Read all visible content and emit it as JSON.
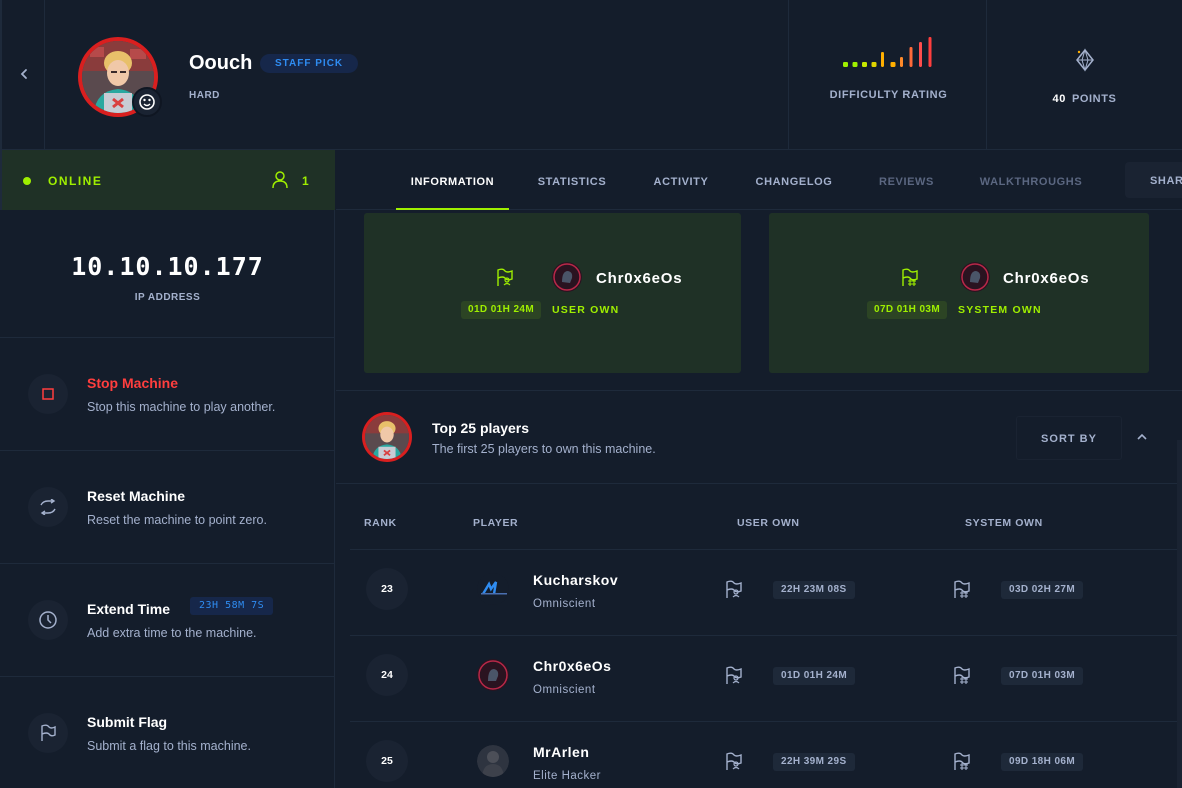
{
  "machine": {
    "name": "Oouch",
    "badge": "STAFF PICK",
    "difficulty": "HARD",
    "difficulty_rating_label": "DIFFICULTY RATING",
    "difficulty_bars": [
      1,
      1,
      1,
      1,
      3,
      1,
      2,
      4,
      5,
      6
    ],
    "points_value": "40",
    "points_label": "POINTS"
  },
  "status": {
    "label": "ONLINE",
    "players": "1",
    "ip": "10.10.10.177",
    "ip_label": "IP ADDRESS"
  },
  "actions": [
    {
      "title": "Stop Machine",
      "sub": "Stop this machine to play another.",
      "icon": "stop-icon"
    },
    {
      "title": "Reset Machine",
      "sub": "Reset the machine to point zero.",
      "icon": "reset-icon"
    },
    {
      "title": "Extend Time",
      "sub": "Add extra time to the machine.",
      "icon": "clock-icon",
      "timer": "23H 58M 7S"
    },
    {
      "title": "Submit Flag",
      "sub": "Submit a flag to this machine.",
      "icon": "flag-icon"
    }
  ],
  "tabs": [
    "INFORMATION",
    "STATISTICS",
    "ACTIVITY",
    "CHANGELOG",
    "REVIEWS",
    "WALKTHROUGHS"
  ],
  "share_label": "SHARE",
  "first_bloods": {
    "user": {
      "player": "Chr0x6eOs",
      "time": "01D 01H 24M",
      "type": "USER OWN"
    },
    "system": {
      "player": "Chr0x6eOs",
      "time": "07D 01H 03M",
      "type": "SYSTEM OWN"
    }
  },
  "top": {
    "title": "Top 25 players",
    "sub": "The first 25 players to own this machine.",
    "sort_label": "SORT BY"
  },
  "table": {
    "headers": [
      "RANK",
      "PLAYER",
      "USER OWN",
      "SYSTEM OWN"
    ],
    "rows": [
      {
        "rank": "23",
        "name": "Kucharskov",
        "title": "Omniscient",
        "user": "22H 23M 08S",
        "system": "03D 02H 27M"
      },
      {
        "rank": "24",
        "name": "Chr0x6eOs",
        "title": "Omniscient",
        "user": "01D 01H 24M",
        "system": "07D 01H 03M"
      },
      {
        "rank": "25",
        "name": "MrArlen",
        "title": "Elite Hacker",
        "user": "22H 39M 29S",
        "system": "09D 18H 06M"
      }
    ]
  },
  "colors": {
    "accent": "#9fef00",
    "danger": "#ff3e3e",
    "info": "#2f8cf1",
    "bg": "#141d2b"
  }
}
